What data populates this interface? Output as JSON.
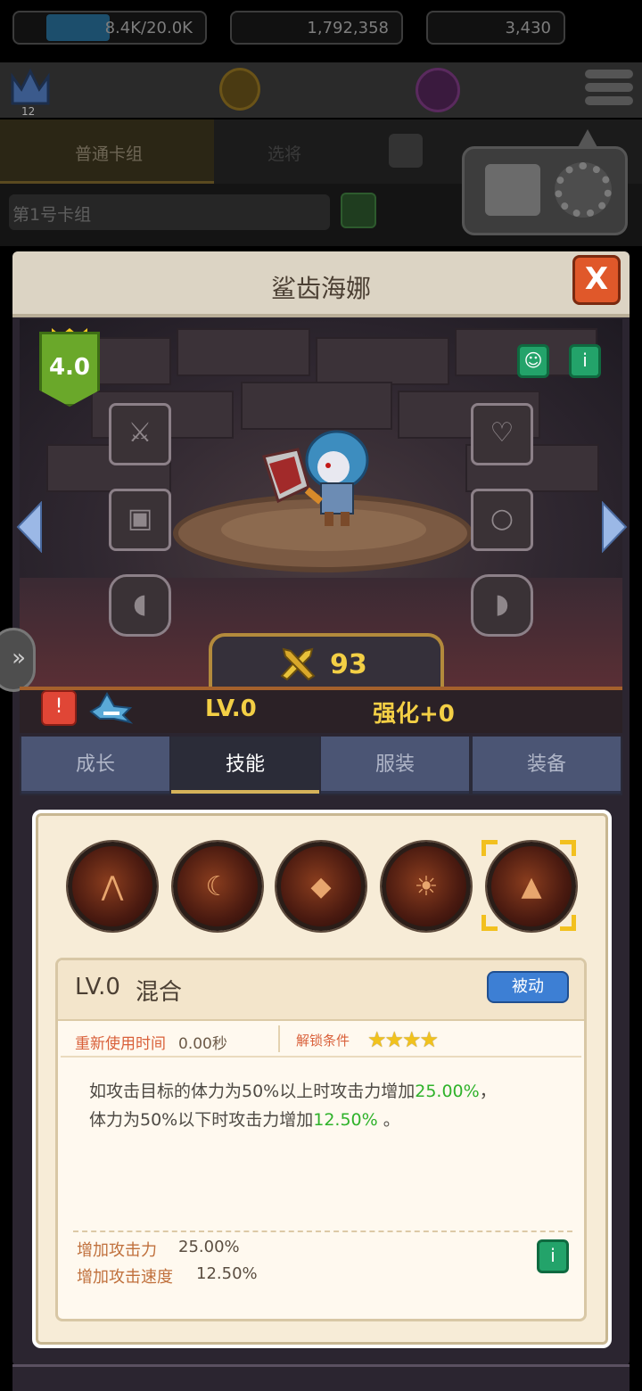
{
  "topbar": {
    "player_level": "12",
    "energy": "8.4K/20.0K",
    "energy_fraction": 0.42,
    "gold": "1,792,358",
    "gems": "3,430"
  },
  "background": {
    "tab_normal_deck": "普通卡组",
    "tab_second": "选将",
    "deck_name": "第1号卡组"
  },
  "panel": {
    "title": "鲨齿海娜",
    "close_label": "X"
  },
  "hero": {
    "grade": "4.0",
    "power": "93",
    "level": "LV.0",
    "enhance": "强化+0"
  },
  "tabs": [
    {
      "label": "成长",
      "active": false
    },
    {
      "label": "技能",
      "active": true
    },
    {
      "label": "服装",
      "active": false
    },
    {
      "label": "装备",
      "active": false
    }
  ],
  "skill": {
    "level": "LV.0",
    "name": "混合",
    "type_label": "被动",
    "reuse_label": "重新使用时间",
    "reuse_value": "0.00秒",
    "unlock_label": "解锁条件",
    "unlock_stars": "★★★★",
    "desc_line1_pre": "如攻击目标的体力为50%以上时攻击力增加",
    "desc_line1_val": "25.00%",
    "desc_line1_post": "，",
    "desc_line2_pre": "体力为50%以下时攻击力增加",
    "desc_line2_val": "12.50%",
    "desc_line2_post": " 。",
    "stats": [
      {
        "label": "增加攻击力",
        "value": "25.00%"
      },
      {
        "label": "增加攻击速度",
        "value": "12.50%"
      }
    ]
  },
  "colors": {
    "accent_gold": "#f3cf45",
    "highlight_green": "#2fb22a",
    "passive_blue": "#3d7fd4",
    "close_orange": "#e0582a"
  }
}
